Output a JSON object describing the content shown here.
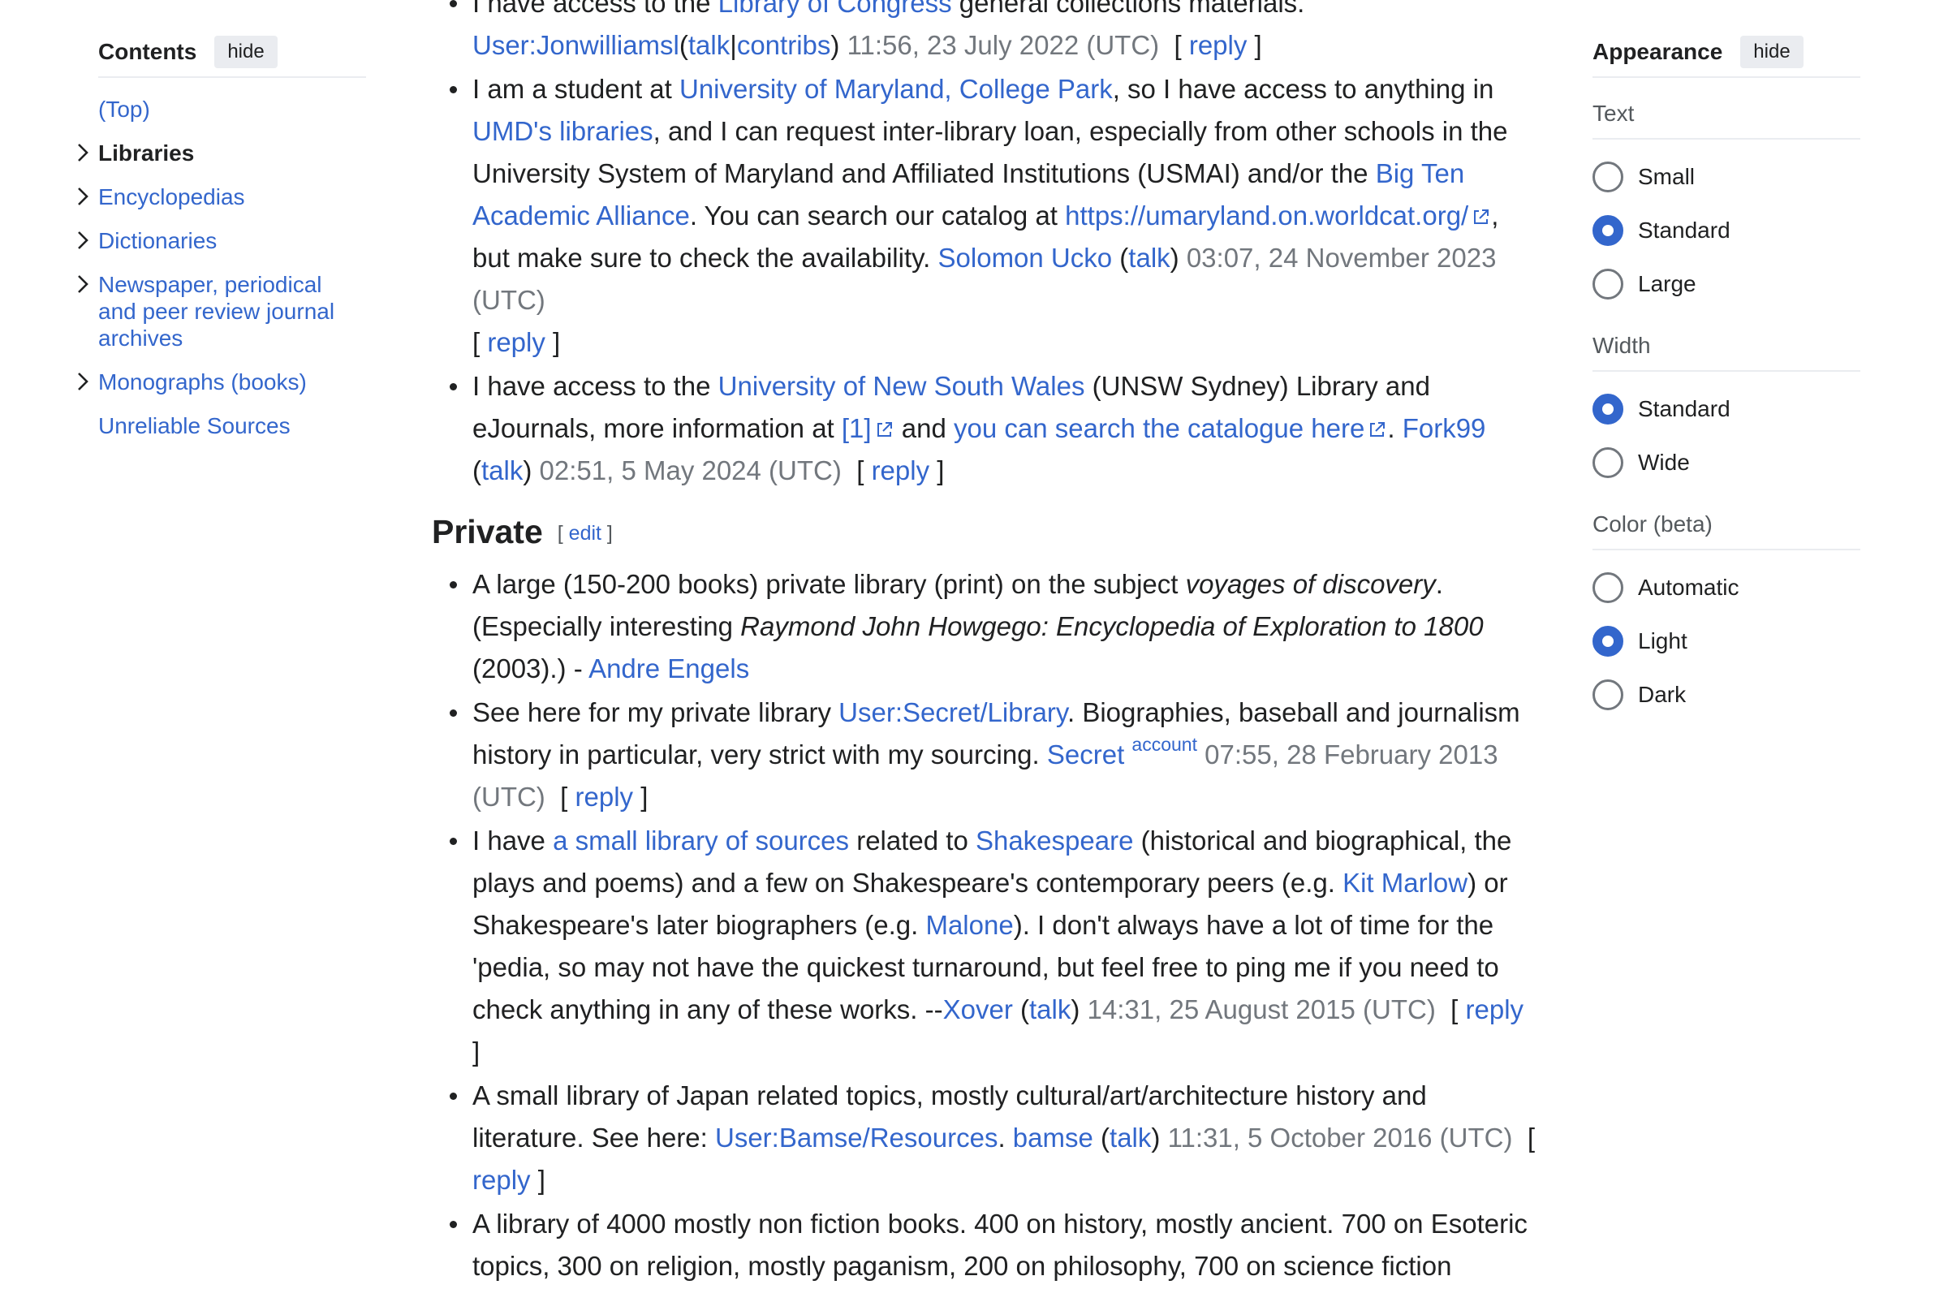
{
  "toc": {
    "title": "Contents",
    "hide_label": "hide",
    "items": [
      {
        "label": "(Top)"
      },
      {
        "label": "Libraries"
      },
      {
        "label": "Encyclopedias"
      },
      {
        "label": "Dictionaries"
      },
      {
        "label": "Newspaper, periodical and peer review journal archives"
      },
      {
        "label": "Monographs (books)"
      },
      {
        "label": "Unreliable Sources"
      }
    ]
  },
  "comments_top": [
    {
      "t1": "I have access to the ",
      "l1": "Library of Congress",
      "t2": " general collections materials.",
      "user": "User:Jonwilliamsl",
      "talk": "talk",
      "sep": "|",
      "contribs": "contribs",
      "ts": "11:56, 23 July 2022 (UTC)",
      "reply": "reply"
    },
    {
      "t1": "I am a student at ",
      "l1": "University of Maryland, College Park",
      "t2": ", so I have access to anything in ",
      "l2": "UMD's libraries",
      "t3": ", and I can request inter-library loan, especially from other schools in the University System of Maryland and Affiliated Institutions (USMAI) and/or the ",
      "l3": "Big Ten Academic Alliance",
      "t4": ". You can search our catalog at ",
      "l4": "https://umaryland.on.worldcat.org/",
      "t5": ", but make sure to check the availability. ",
      "user": "Solomon Ucko",
      "talk": "talk",
      "ts": "03:07, 24 November 2023 (UTC)",
      "reply": "reply"
    },
    {
      "t1": "I have access to the ",
      "l1": "University of New South Wales",
      "t2": " (UNSW Sydney) Library and eJournals, more information at ",
      "l2": "[1]",
      "t3": " and ",
      "l3": "you can search the catalogue here",
      "t4": ". ",
      "user": "Fork99",
      "talk": "talk",
      "ts": "02:51, 5 May 2024 (UTC)",
      "reply": "reply"
    }
  ],
  "section": {
    "title": "Private",
    "edit": "edit"
  },
  "comments_private": [
    {
      "t1": "A large (150-200 books) private library (print) on the subject ",
      "i1": "voyages of discovery",
      "t2": ". (Especially interesting ",
      "i2": "Raymond John Howgego: Encyclopedia of Exploration to 1800",
      "t3": " (2003).) - ",
      "user": "Andre Engels"
    },
    {
      "t1": "See here for my private library ",
      "l1": "User:Secret/Library",
      "t2": ". Biographies, baseball and journalism history in particular, very strict with my sourcing. ",
      "user": "Secret",
      "sup": "account",
      "ts": "07:55, 28 February 2013 (UTC)",
      "reply": "reply"
    },
    {
      "t1": "I have ",
      "l1": "a small library of sources",
      "t2": " related to ",
      "l2": "Shakespeare",
      "t3": " (historical and biographical, the plays and poems) and a few on Shakespeare's contemporary peers (e.g. ",
      "l3": "Kit Marlow",
      "t4": ") or Shakespeare's later biographers (e.g. ",
      "l4": "Malone",
      "t5": "). I don't always have a lot of time for the 'pedia, so may not have the quickest turnaround, but feel free to ping me if you need to check anything in any of these works. --",
      "user": "Xover",
      "talk": "talk",
      "ts": "14:31, 25 August 2015 (UTC)",
      "reply": "reply"
    },
    {
      "t1": "A small library of Japan related topics, mostly cultural/art/architecture history and literature. See here: ",
      "l1": "User:Bamse/Resources",
      "t2": ". ",
      "user": "bamse",
      "talk": "talk",
      "ts": "11:31, 5 October 2016 (UTC)",
      "reply": "reply"
    },
    {
      "t1": "A library of 4000 mostly non fiction books. 400 on history, mostly ancient. 700 on Esoteric topics, 300 on religion, mostly paganism, 200 on philosophy, 700 on science fiction"
    }
  ],
  "appearance": {
    "title": "Appearance",
    "hide_label": "hide",
    "groups": [
      {
        "label": "Text",
        "options": [
          {
            "label": "Small"
          },
          {
            "label": "Standard"
          },
          {
            "label": "Large"
          }
        ],
        "selected": "Standard"
      },
      {
        "label": "Width",
        "options": [
          {
            "label": "Standard"
          },
          {
            "label": "Wide"
          }
        ],
        "selected": "Standard"
      },
      {
        "label": "Color (beta)",
        "options": [
          {
            "label": "Automatic"
          },
          {
            "label": "Light"
          },
          {
            "label": "Dark"
          }
        ],
        "selected": "Light"
      }
    ]
  },
  "colors": {
    "link": "#3366cc",
    "text": "#202122",
    "timestamp": "#72777d",
    "border": "#eaecf0"
  },
  "icons": {
    "external_link": "external-link-icon",
    "chevron": "chevron-right-icon"
  }
}
